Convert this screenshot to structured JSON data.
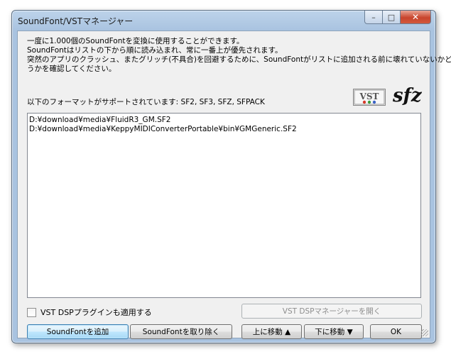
{
  "window": {
    "title": "SoundFont/VSTマネージャー",
    "min_glyph": "–",
    "max_glyph": "□",
    "close_glyph": "✕"
  },
  "info_lines": [
    "一度に1.000個のSoundFontを変換に使用することができます。",
    "SoundFontはリストの下から順に読み込まれ、常に一番上が優先されます。",
    "突然のアプリのクラッシュ、またグリッチ(不具合)を回避するために、SoundFontがリストに追加される前に壊れていないかど",
    "うかを確認してください。"
  ],
  "formats_text": "以下のフォーマットがサポートされています: SF2, SF3, SFZ, SFPACK",
  "logos": {
    "vst": "VST",
    "sfz": "sfz"
  },
  "soundfont_list": [
    "D:¥download¥media¥FluidR3_GM.SF2",
    "D:¥download¥media¥KeppyMIDIConverterPortable¥bin¥GMGeneric.SF2"
  ],
  "vst_checkbox_label": "VST DSPプラグインも適用する",
  "buttons": {
    "open_vst": "VST DSPマネージャーを開く",
    "add": "SoundFontを追加",
    "remove": "SoundFontを取り除く",
    "move_up": "上に移動 ▲",
    "move_down": "下に移動 ▼",
    "ok": "OK"
  }
}
